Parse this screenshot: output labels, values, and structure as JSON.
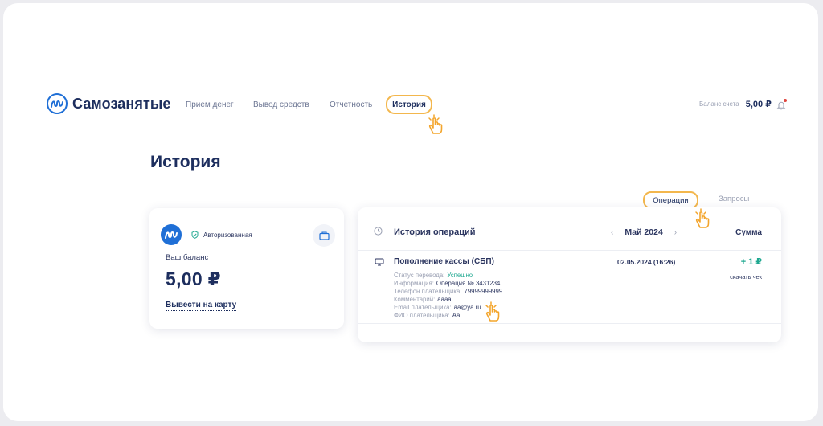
{
  "header": {
    "logo_text": "Самозанятые",
    "nav": [
      {
        "label": "Прием денег"
      },
      {
        "label": "Вывод средств"
      },
      {
        "label": "Отчетность"
      },
      {
        "label": "История"
      }
    ],
    "balance_label": "Баланс счета",
    "balance_value": "5,00 ₽"
  },
  "page": {
    "title": "История"
  },
  "tabs": {
    "operations": "Операции",
    "requests": "Запросы"
  },
  "balance_card": {
    "status": "Авторизованная",
    "label": "Ваш баланс",
    "amount": "5,00 ₽",
    "withdraw_link": "Вывести на карту"
  },
  "history": {
    "title": "История операций",
    "month": "Май 2024",
    "prev": "‹",
    "next": "›",
    "sum_header": "Сумма",
    "operation": {
      "title": "Пополнение кассы (СБП)",
      "date": "02.05.2024 (16:26)",
      "amount": "+ 1 ₽",
      "receipt_link": "скачать чек",
      "details": [
        {
          "key": "Статус перевода:",
          "value": "Успешно"
        },
        {
          "key": "Информация:",
          "value": "Операция № 3431234"
        },
        {
          "key": "Телефон плательщика:",
          "value": "79999999999"
        },
        {
          "key": "Комментарий:",
          "value": "аааа"
        },
        {
          "key": "Email плательщика:",
          "value": "aa@ya.ru"
        },
        {
          "key": "ФИО плательщика:",
          "value": "Аа"
        }
      ]
    }
  },
  "colors": {
    "brand_blue": "#1f6fd6",
    "navy": "#1d2e5e",
    "highlight": "#f3b74d",
    "success": "#1fa890"
  },
  "icons": [
    "logo-icon",
    "bell-icon",
    "shield-icon",
    "wallet-icon",
    "clock-icon",
    "terminal-icon",
    "hand-pointer-icon"
  ]
}
